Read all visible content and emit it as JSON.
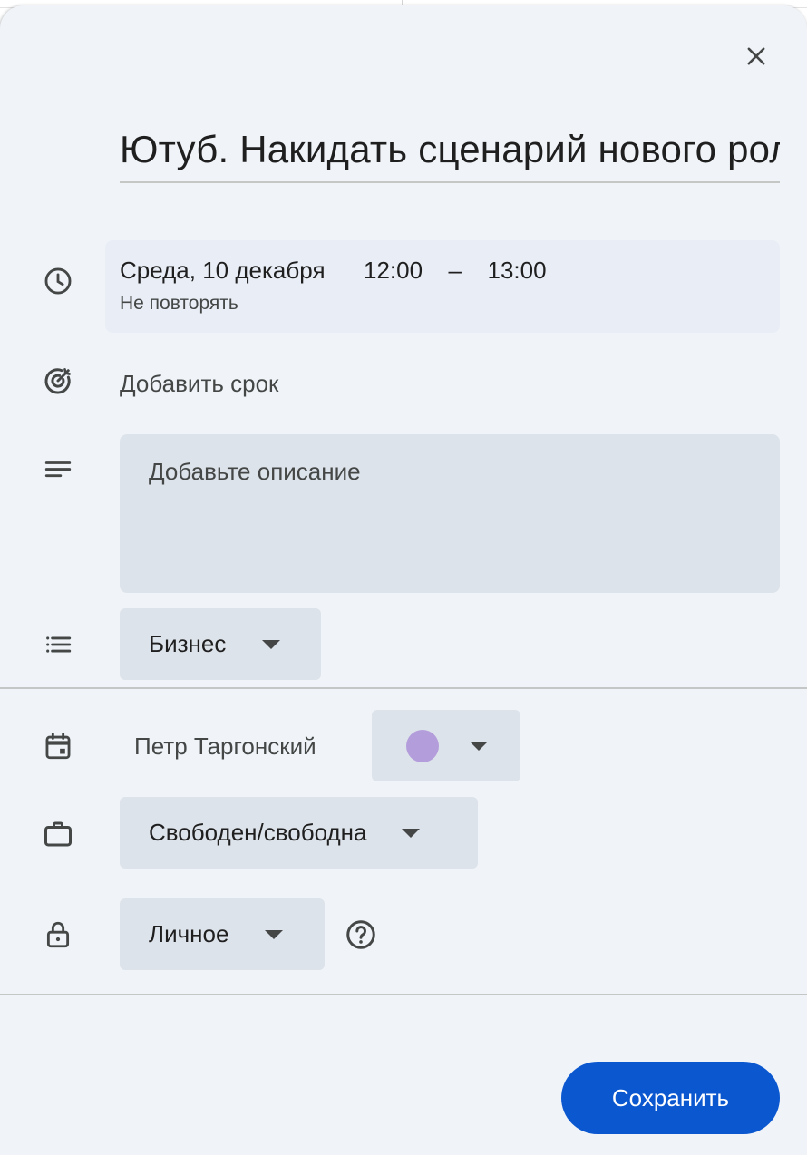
{
  "dialog": {
    "title": "Ютуб. Накидать сценарий нового ролика",
    "close_icon": "close-icon"
  },
  "datetime": {
    "date": "Среда, 10 декабря",
    "start": "12:00",
    "separator": "–",
    "end": "13:00",
    "repeat": "Не повторять",
    "icon": "clock-icon"
  },
  "deadline": {
    "label": "Добавить срок",
    "icon": "target-icon"
  },
  "description": {
    "placeholder": "Добавьте описание",
    "icon": "notes-icon"
  },
  "task_list": {
    "selected": "Бизнес",
    "icon": "list-icon"
  },
  "calendar": {
    "owner": "Петр Таргонский",
    "color": "#b39ddb",
    "icon": "calendar-icon"
  },
  "availability": {
    "selected": "Свободен/свободна",
    "icon": "briefcase-icon"
  },
  "visibility": {
    "selected": "Личное",
    "icon": "lock-icon",
    "help_icon": "help-icon"
  },
  "actions": {
    "save_label": "Сохранить"
  },
  "colors": {
    "accent": "#0b57d0",
    "dialog_bg": "#f0f4f9",
    "field_bg": "#dde3ea"
  }
}
